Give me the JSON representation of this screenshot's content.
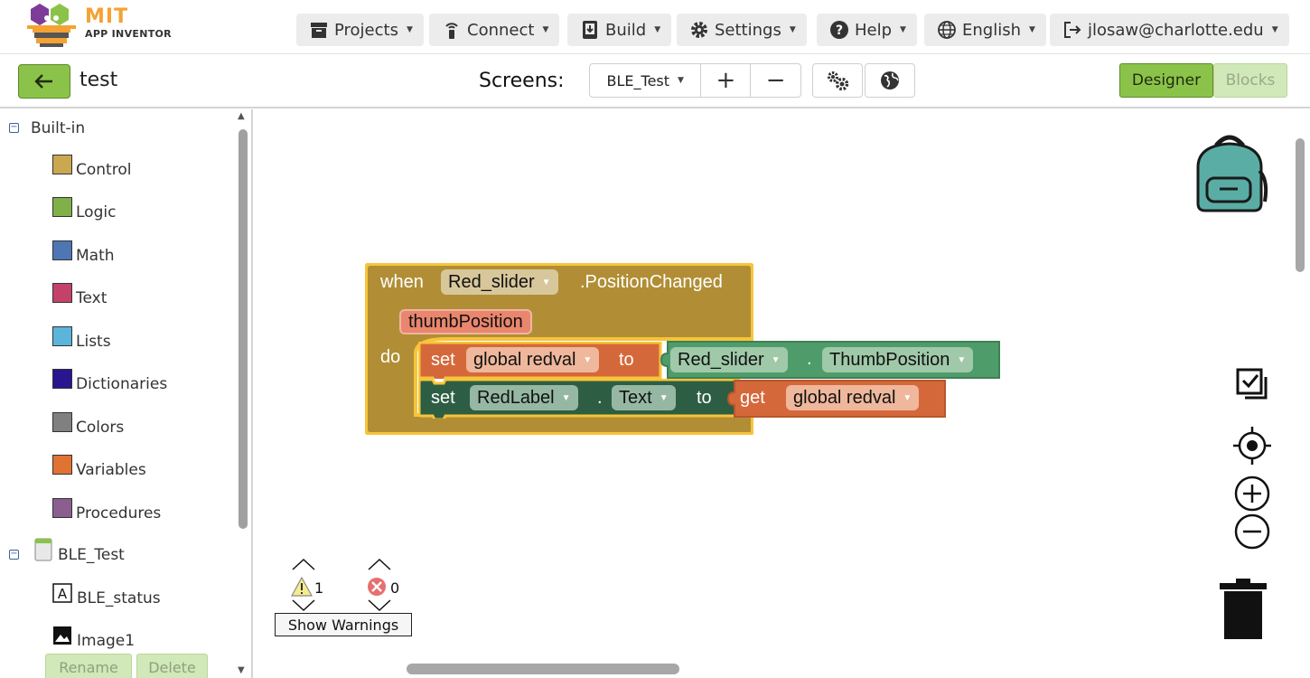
{
  "app": {
    "logo_title": "MIT",
    "logo_subtitle": "APP INVENTOR",
    "brand_color": "#f4a233"
  },
  "nav": {
    "items": [
      {
        "label": "Projects",
        "icon": "projects-icon"
      },
      {
        "label": "Connect",
        "icon": "connect-icon"
      },
      {
        "label": "Build",
        "icon": "build-icon"
      },
      {
        "label": "Settings",
        "icon": "gear-icon"
      },
      {
        "label": "Help",
        "icon": "help-icon"
      },
      {
        "label": "English",
        "icon": "globe-icon"
      },
      {
        "label": "jlosaw@charlotte.edu",
        "icon": "logout-icon"
      }
    ]
  },
  "project": {
    "name": "test",
    "screens_label": "Screens:",
    "current_screen": "BLE_Test",
    "add_screen": "+",
    "remove_screen": "−",
    "designer_label": "Designer",
    "blocks_label": "Blocks",
    "accent_color": "#8bc34a"
  },
  "sidebar": {
    "builtin_label": "Built-in",
    "categories": [
      {
        "label": "Control",
        "color": "#c9a84f"
      },
      {
        "label": "Logic",
        "color": "#80b048"
      },
      {
        "label": "Math",
        "color": "#4f76b4"
      },
      {
        "label": "Text",
        "color": "#c4426a"
      },
      {
        "label": "Lists",
        "color": "#5bb4d9"
      },
      {
        "label": "Dictionaries",
        "color": "#2a1591"
      },
      {
        "label": "Colors",
        "color": "#808080"
      },
      {
        "label": "Variables",
        "color": "#e07232"
      },
      {
        "label": "Procedures",
        "color": "#8a5e8f"
      }
    ],
    "screen_node": "BLE_Test",
    "components": [
      {
        "label": "BLE_status",
        "icon": "label-icon"
      },
      {
        "label": "Image1",
        "icon": "image-icon"
      }
    ],
    "rename_label": "Rename",
    "delete_label": "Delete"
  },
  "blocks": {
    "event": {
      "when": "when",
      "component": "Red_slider",
      "event_name": ".PositionChanged",
      "param": "thumbPosition",
      "do": "do",
      "color": "#b18e35"
    },
    "stmt1": {
      "set": "set",
      "variable": "global redval",
      "to": "to",
      "value_component": "Red_slider",
      "dot": ".",
      "value_property": "ThumbPosition"
    },
    "stmt2": {
      "set": "set",
      "component": "RedLabel",
      "dot": ".",
      "property": "Text",
      "to": "to",
      "get": "get",
      "variable": "global redval"
    }
  },
  "warnings": {
    "warning_count": "1",
    "error_count": "0",
    "show_label": "Show Warnings"
  }
}
